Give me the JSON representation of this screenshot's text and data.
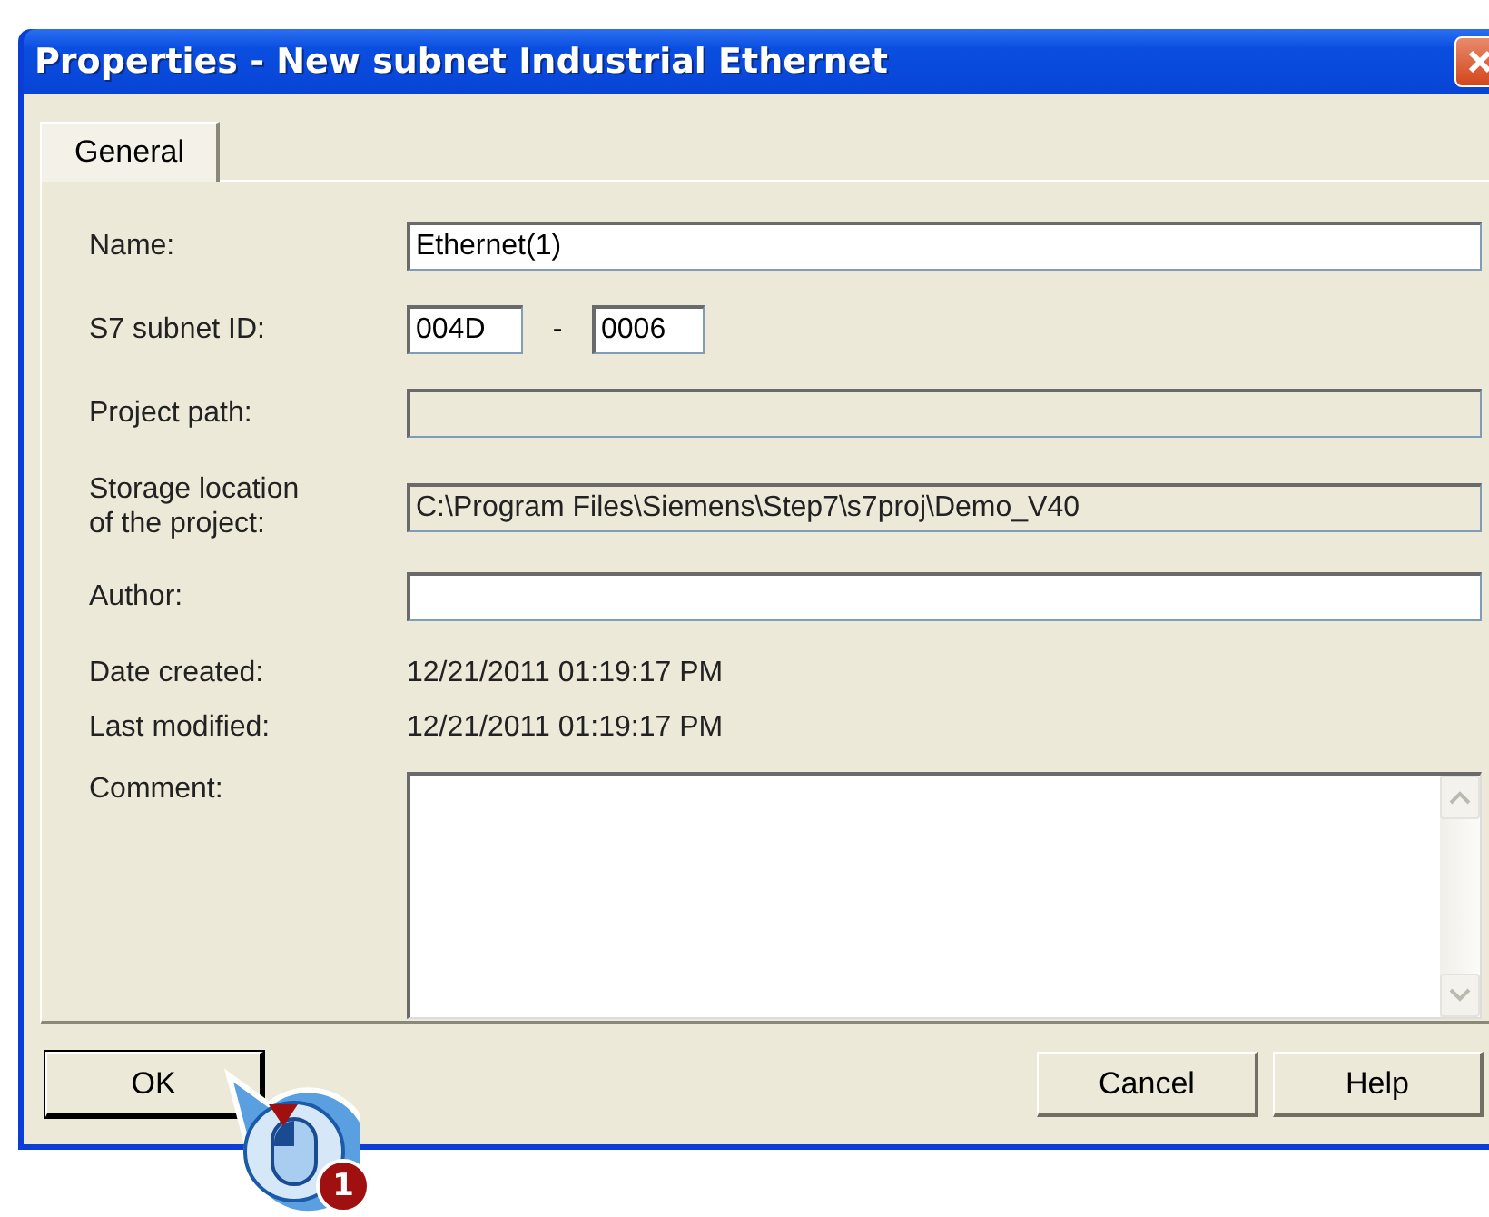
{
  "window": {
    "title": "Properties -  New subnet Industrial Ethernet"
  },
  "tabs": [
    {
      "label": "General",
      "selected": true
    }
  ],
  "fields": [
    {
      "kind": "input",
      "label": "Name:",
      "value": "Ethernet(1)",
      "disabled": false
    },
    {
      "kind": "id_pair",
      "label": "S7 subnet ID:",
      "values": [
        "004D",
        "0006"
      ],
      "separator": "-"
    },
    {
      "kind": "input",
      "label": "Project path:",
      "disabled": true
    },
    {
      "kind": "input",
      "label": "Storage location\nof the project:",
      "value": "C:\\Program Files\\Siemens\\Step7\\s7proj\\Demo_V40",
      "disabled": true
    },
    {
      "kind": "input",
      "label": "Author:",
      "disabled": false
    },
    {
      "kind": "static",
      "label": "Date created:",
      "value": "12/21/2011 01:19:17 PM"
    },
    {
      "kind": "static",
      "label": "Last modified:",
      "value": "12/21/2011 01:19:17 PM"
    },
    {
      "kind": "multiline",
      "label": "Comment:"
    }
  ],
  "buttons": [
    {
      "label": "OK",
      "focused": true
    },
    {
      "label": "Cancel",
      "focused": false
    },
    {
      "label": "Help",
      "focused": false
    }
  ],
  "callout": {
    "step": "1"
  }
}
